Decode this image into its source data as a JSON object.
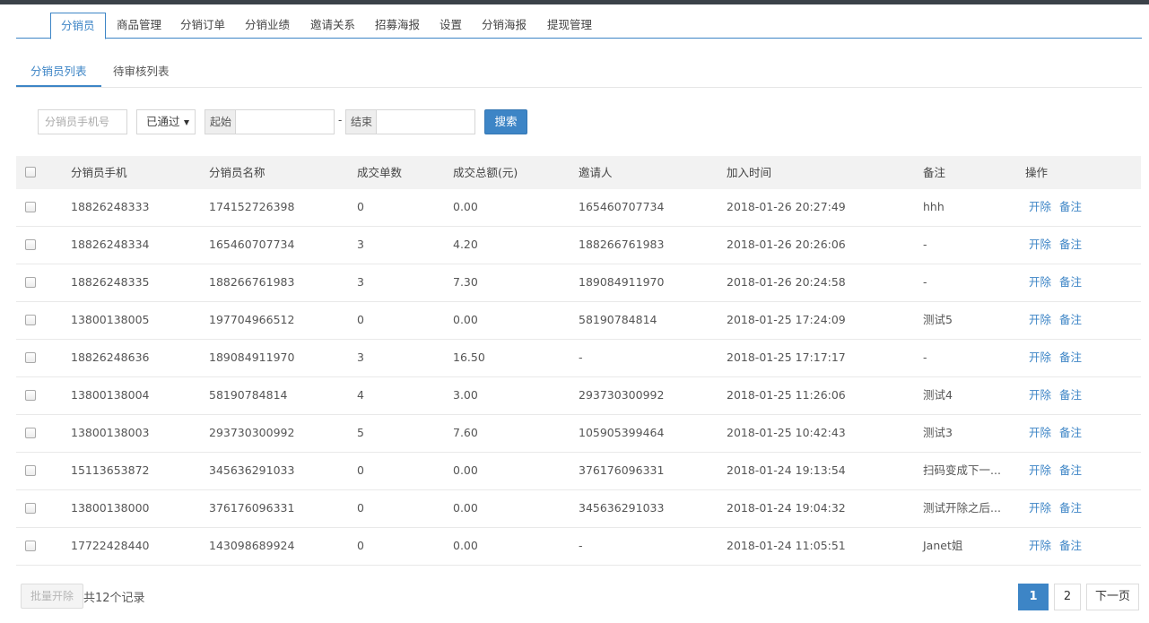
{
  "main_tabs": [
    {
      "label": "分销员",
      "active": true
    },
    {
      "label": "商品管理"
    },
    {
      "label": "分销订单"
    },
    {
      "label": "分销业绩"
    },
    {
      "label": "邀请关系"
    },
    {
      "label": "招募海报"
    },
    {
      "label": "设置"
    },
    {
      "label": "分销海报"
    },
    {
      "label": "提现管理"
    }
  ],
  "sub_tabs": [
    {
      "label": "分销员列表",
      "active": true
    },
    {
      "label": "待审核列表"
    }
  ],
  "filter": {
    "phone_placeholder": "分销员手机号",
    "status_value": "已通过",
    "start_label": "起始",
    "dash": "-",
    "end_label": "结束",
    "search_label": "搜索"
  },
  "table": {
    "headers": [
      "分销员手机",
      "分销员名称",
      "成交单数",
      "成交总额(元)",
      "邀请人",
      "加入时间",
      "备注",
      "操作"
    ],
    "rows": [
      {
        "phone": "18826248333",
        "name": "174152726398",
        "orders": "0",
        "amount": "0.00",
        "inviter": "165460707734",
        "joined": "2018-01-26 20:27:49",
        "remark": "hhh"
      },
      {
        "phone": "18826248334",
        "name": "165460707734",
        "orders": "3",
        "amount": "4.20",
        "inviter": "188266761983",
        "joined": "2018-01-26 20:26:06",
        "remark": "-"
      },
      {
        "phone": "18826248335",
        "name": "188266761983",
        "orders": "3",
        "amount": "7.30",
        "inviter": "189084911970",
        "joined": "2018-01-26 20:24:58",
        "remark": "-"
      },
      {
        "phone": "13800138005",
        "name": "197704966512",
        "orders": "0",
        "amount": "0.00",
        "inviter": "58190784814",
        "joined": "2018-01-25 17:24:09",
        "remark": "测试5"
      },
      {
        "phone": "18826248636",
        "name": "189084911970",
        "orders": "3",
        "amount": "16.50",
        "inviter": "-",
        "joined": "2018-01-25 17:17:17",
        "remark": "-"
      },
      {
        "phone": "13800138004",
        "name": "58190784814",
        "orders": "4",
        "amount": "3.00",
        "inviter": "293730300992",
        "joined": "2018-01-25 11:26:06",
        "remark": "测试4"
      },
      {
        "phone": "13800138003",
        "name": "293730300992",
        "orders": "5",
        "amount": "7.60",
        "inviter": "105905399464",
        "joined": "2018-01-25 10:42:43",
        "remark": "测试3"
      },
      {
        "phone": "15113653872",
        "name": "345636291033",
        "orders": "0",
        "amount": "0.00",
        "inviter": "376176096331",
        "joined": "2018-01-24 19:13:54",
        "remark": "扫码变成下一..."
      },
      {
        "phone": "13800138000",
        "name": "376176096331",
        "orders": "0",
        "amount": "0.00",
        "inviter": "345636291033",
        "joined": "2018-01-24 19:04:32",
        "remark": "测试开除之后..."
      },
      {
        "phone": "17722428440",
        "name": "143098689924",
        "orders": "0",
        "amount": "0.00",
        "inviter": "-",
        "joined": "2018-01-24 11:05:51",
        "remark": "Janet姐"
      }
    ],
    "actions": {
      "fire": "开除",
      "remark": "备注"
    }
  },
  "footer": {
    "batch_label": "批量开除",
    "total_text": "共12个记录",
    "pages": [
      "1",
      "2"
    ],
    "next_label": "下一页"
  },
  "icons": {
    "status_select": "chevron-down-icon"
  },
  "colors": {
    "accent": "#3d85c6",
    "topbar": "#3b4249"
  }
}
